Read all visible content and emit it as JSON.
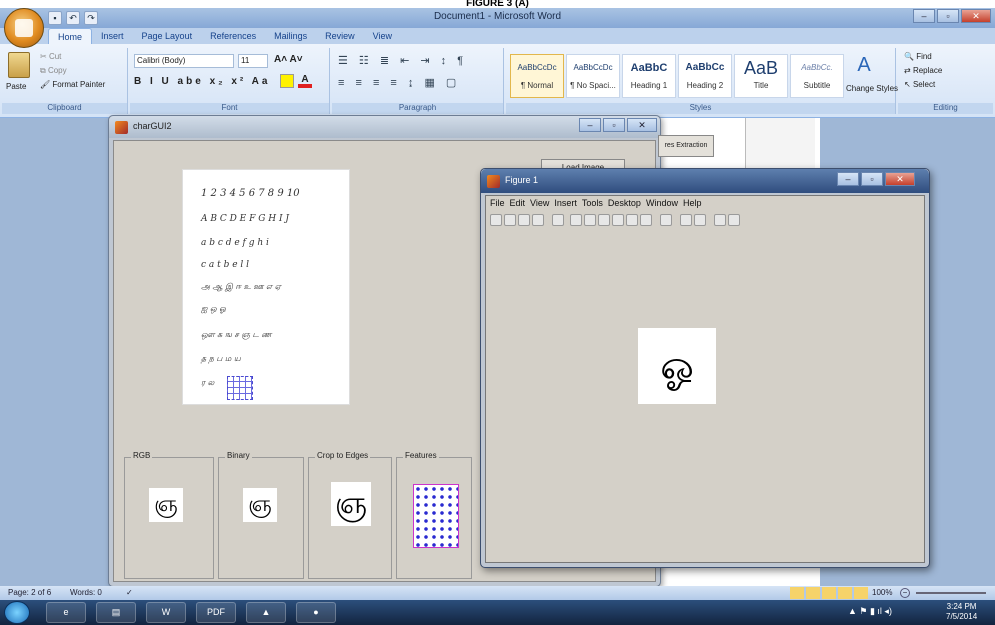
{
  "caption": "FIGURE 3 (A)",
  "word": {
    "title": "Document1 - Microsoft Word",
    "tabs": [
      "Home",
      "Insert",
      "Page Layout",
      "References",
      "Mailings",
      "Review",
      "View"
    ],
    "clipboard": {
      "paste": "Paste",
      "cut": "Cut",
      "copy": "Copy",
      "format_painter": "Format Painter",
      "label": "Clipboard"
    },
    "font": {
      "name": "Calibri (Body)",
      "size": "11",
      "label": "Font"
    },
    "paragraph": {
      "label": "Paragraph"
    },
    "styles": {
      "items": [
        {
          "preview": "AaBbCcDc",
          "name": "¶ Normal"
        },
        {
          "preview": "AaBbCcDc",
          "name": "¶ No Spaci..."
        },
        {
          "preview": "AaBbC",
          "name": "Heading 1"
        },
        {
          "preview": "AaBbCc",
          "name": "Heading 2"
        },
        {
          "preview": "AaB",
          "name": "Title"
        },
        {
          "preview": "AaBbCc.",
          "name": "Subtitle"
        }
      ],
      "change": "Change Styles",
      "label": "Styles"
    },
    "editing": {
      "find": "Find",
      "replace": "Replace",
      "select": "Select",
      "label": "Editing"
    },
    "status": {
      "page": "Page: 2 of 6",
      "words": "Words: 0",
      "zoom": "100%"
    }
  },
  "gui": {
    "title": "charGUI2",
    "load_button": "Load Image",
    "features_button": "res Extraction",
    "panels": [
      "RGB",
      "Binary",
      "Crop to Edges",
      "Features"
    ],
    "sample_lines": [
      "1 2 3 4 5 6 7 8 9 10",
      "A B C D E F G H I J",
      "a b c d e f g h i",
      "c a t  b e l l",
      "அ ஆ இ ஈ உ ஊ எ ஏ",
      "ஐ ஒ ஓ",
      "ஔ க ங ச ஞ ட ண",
      "த ந ப ம ய",
      "ர ல"
    ]
  },
  "figure": {
    "title": "Figure 1",
    "menu": [
      "File",
      "Edit",
      "View",
      "Insert",
      "Tools",
      "Desktop",
      "Window",
      "Help"
    ]
  },
  "taskbar": {
    "time": "3:24 PM",
    "date": "7/5/2014"
  },
  "colors": {
    "ribbon": "#dfe9f5",
    "doc_bg": "#9fb7d6",
    "gui_bg": "#d4d0c8",
    "feature_border": "#cc33cc"
  }
}
